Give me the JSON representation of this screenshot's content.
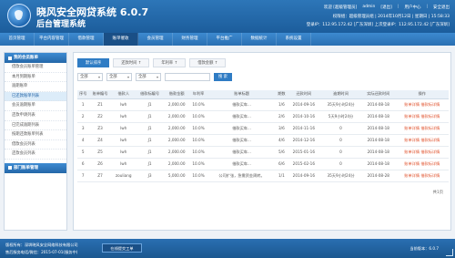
{
  "header": {
    "title": "晓风安全网贷系统 6.0.7",
    "subtitle": "后台管理系统",
    "welcome": "欢迎 [超级管理员]",
    "user": "admin",
    "logout": "[退出]",
    "links": [
      "用户中心",
      "安全退出"
    ],
    "status": "权限组：超级管理员组 | 2014年10月12日 | 星期日 | 15:58:33",
    "ip": "登录IP：112.95.172.42 [广东深圳]  上次登录IP：112.95.172.42 [广东深圳]"
  },
  "nav": [
    "首页管理",
    "平台内容管理",
    "借款管理",
    "账单催收",
    "会员管理",
    "财务管理",
    "平台推广",
    "数据统计",
    "系统设置"
  ],
  "nav_active_index": 3,
  "sidebar": {
    "group1_title": "我的会员账单",
    "items": [
      "借款会员账单管理",
      "本月到期账单",
      "逾期账单",
      "已还款账单列表",
      "会员逾期账单",
      "还款申请列表",
      "已完成逾期列表",
      "按期还款账单列表",
      "借款会员列表",
      "还款会员列表"
    ],
    "active_index": 3,
    "group2_title": "部门账单管理"
  },
  "tabs": [
    "默认排序",
    "还款时间 ↑",
    "年利率 ↑",
    "借款金额 ↑"
  ],
  "filters": {
    "select1": "全部",
    "select2": "全部",
    "select3": "全部",
    "search_button": "搜 索"
  },
  "table": {
    "columns": [
      "序号",
      "账单编号",
      "借款人",
      "借款标编号",
      "借款金额",
      "年利率",
      "账单标题",
      "期数",
      "还款时间",
      "逾期时间",
      "实际还款时间",
      "操作"
    ],
    "rows": [
      [
        "1",
        "Z1",
        "lwh",
        "J1",
        "2,000.00",
        "10.0%",
        "借款买车...",
        "1/6",
        "2014-09-16",
        "35天9小时24分",
        "2014-08-18",
        "账单详情 借款标详情"
      ],
      [
        "2",
        "Z2",
        "lwh",
        "J1",
        "2,000.00",
        "10.0%",
        "借款买车...",
        "2/6",
        "2014-10-16",
        "5天9小时24分",
        "2014-08-18",
        "账单详情 借款标详情"
      ],
      [
        "3",
        "Z3",
        "lwh",
        "J1",
        "2,000.00",
        "10.0%",
        "借款买车...",
        "3/6",
        "2014-11-16",
        "0",
        "2014-08-18",
        "账单详情 借款标详情"
      ],
      [
        "4",
        "Z4",
        "lwh",
        "J1",
        "2,000.00",
        "10.0%",
        "借款买车...",
        "4/6",
        "2014-12-16",
        "0",
        "2014-08-18",
        "账单详情 借款标详情"
      ],
      [
        "5",
        "Z5",
        "lwh",
        "J1",
        "2,000.00",
        "10.0%",
        "借款买车...",
        "5/6",
        "2015-01-16",
        "0",
        "2014-08-18",
        "账单详情 借款标详情"
      ],
      [
        "6",
        "Z6",
        "lwh",
        "J1",
        "2,000.00",
        "10.0%",
        "借款买车...",
        "6/6",
        "2015-02-16",
        "0",
        "2014-08-18",
        "账单详情 借款标详情"
      ],
      [
        "7",
        "Z7",
        "zouliang",
        "J3",
        "5,000.00",
        "10.0%",
        "公司扩张，急需资金周转。",
        "1/1",
        "2014-09-16",
        "35天9小时24分",
        "2014-08-28",
        "账单详情 借款标详情"
      ]
    ]
  },
  "pager": "共1页",
  "footer": {
    "line1": "版权所有：深圳晓风安全网络科技有限公司",
    "line2": "售后服务电话/微信：2015-07-01(服务中)",
    "service_button": "在线提交工单",
    "version": "当前版本：6.0.7"
  }
}
